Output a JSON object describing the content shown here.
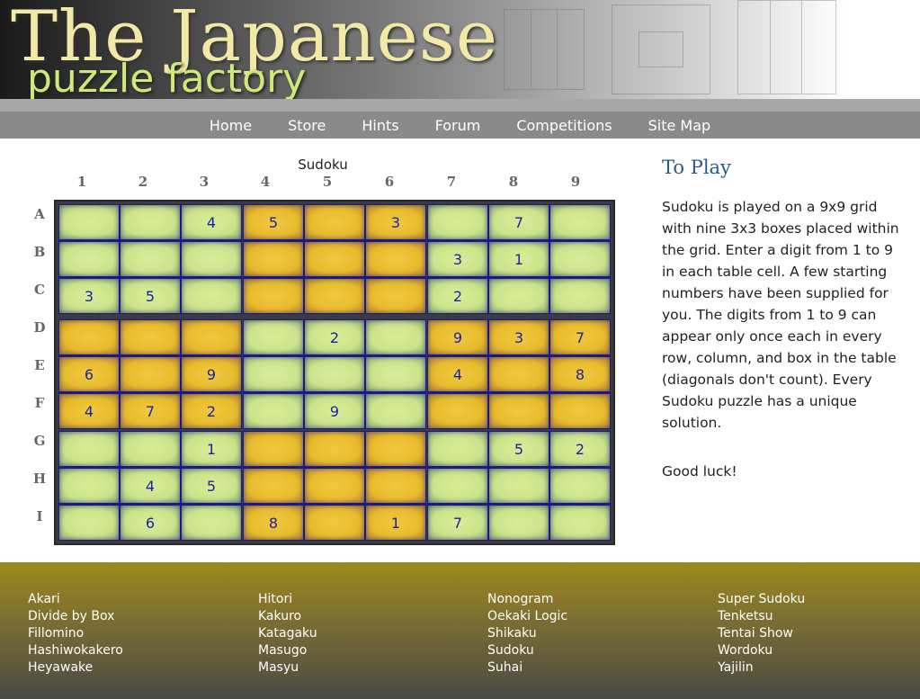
{
  "header": {
    "logo_line1": "The Japanese",
    "logo_line2": "puzzle factory"
  },
  "nav": [
    {
      "label": "Home"
    },
    {
      "label": "Store"
    },
    {
      "label": "Hints"
    },
    {
      "label": "Forum"
    },
    {
      "label": "Competitions"
    },
    {
      "label": "Site Map"
    }
  ],
  "puzzle": {
    "title": "Sudoku",
    "columns": [
      "1",
      "2",
      "3",
      "4",
      "5",
      "6",
      "7",
      "8",
      "9"
    ],
    "rows": [
      "A",
      "B",
      "C",
      "D",
      "E",
      "F",
      "G",
      "H",
      "I"
    ],
    "grid": [
      [
        "",
        "",
        "4",
        "5",
        "",
        "3",
        "",
        "7",
        ""
      ],
      [
        "",
        "",
        "",
        "",
        "",
        "",
        "3",
        "1",
        ""
      ],
      [
        "3",
        "5",
        "",
        "",
        "",
        "",
        "2",
        "",
        ""
      ],
      [
        "",
        "",
        "",
        "",
        "2",
        "",
        "9",
        "3",
        "7"
      ],
      [
        "6",
        "",
        "9",
        "",
        "",
        "",
        "4",
        "",
        "8"
      ],
      [
        "4",
        "7",
        "2",
        "",
        "9",
        "",
        "",
        "",
        ""
      ],
      [
        "",
        "",
        "1",
        "",
        "",
        "",
        "",
        "5",
        "2"
      ],
      [
        "",
        "4",
        "5",
        "",
        "",
        "",
        "",
        "",
        ""
      ],
      [
        "",
        "6",
        "",
        "8",
        "",
        "1",
        "7",
        "",
        ""
      ]
    ],
    "colors": {
      "light_box": "#cbe38a",
      "dark_box": "#e8bb2c",
      "digit": "#1a24a0"
    }
  },
  "sidebar": {
    "heading": "To Play",
    "text": "Sudoku is played on a 9x9 grid with nine 3x3 boxes placed within the grid. Enter a digit from 1 to 9 in each table cell. A few starting numbers have been supplied for you. The digits from 1 to 9 can appear only once each in every row, column, and box in the table (diagonals don't count). Every Sudoku puzzle has a unique solution.",
    "luck": "Good luck!"
  },
  "footer": {
    "columns": [
      [
        "Akari",
        "Divide by Box",
        "Fillomino",
        "Hashiwokakero",
        "Heyawake"
      ],
      [
        "Hitori",
        "Kakuro",
        "Katagaku",
        "Masugo",
        "Masyu"
      ],
      [
        "Nonogram",
        "Oekaki Logic",
        "Shikaku",
        "Sudoku",
        "Suhai"
      ],
      [
        "Super Sudoku",
        "Tenketsu",
        "Tentai Show",
        "Wordoku",
        "Yajilin"
      ]
    ]
  }
}
